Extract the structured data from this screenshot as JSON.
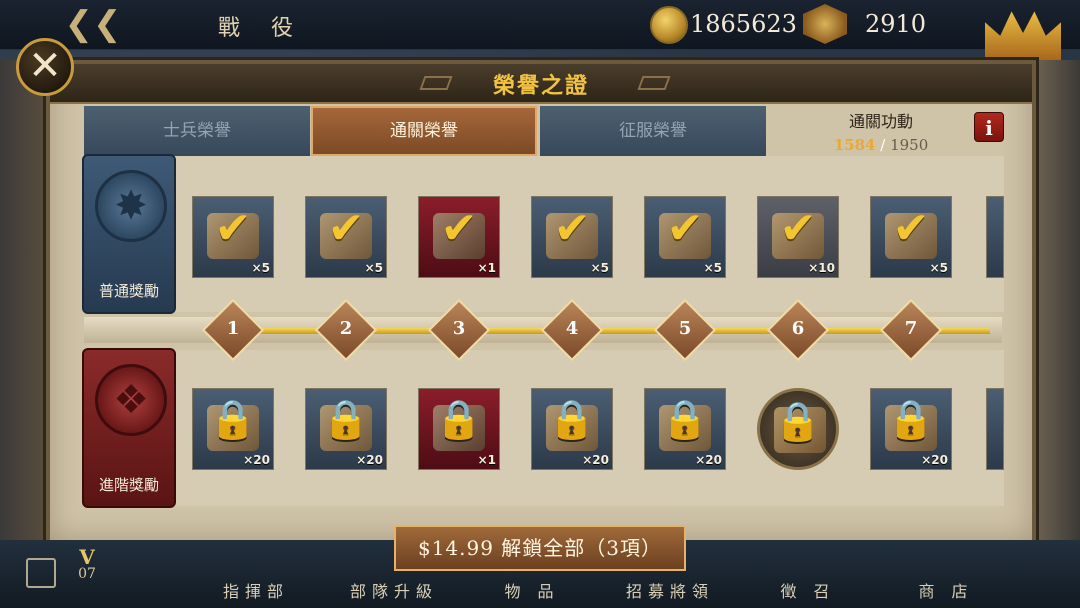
{
  "top_bar": {
    "title": "戰 役",
    "coins": "1865623",
    "crowns": "2910"
  },
  "modal": {
    "title": "榮譽之證",
    "tabs": [
      {
        "label": "士兵榮譽",
        "active": false
      },
      {
        "label": "通關榮譽",
        "active": true
      },
      {
        "label": "征服榮譽",
        "active": false
      }
    ],
    "merit": {
      "label": "通關功動",
      "current": "1584",
      "separator": "/",
      "max": "1950"
    },
    "info_glyph": "i",
    "rows": {
      "normal_label": "普通獎勵",
      "advanced_label": "進階獎勵"
    },
    "levels": [
      "1",
      "2",
      "3",
      "4",
      "5",
      "6",
      "7"
    ],
    "normal_rewards": [
      {
        "icon": "drum-icon",
        "qty": "×5",
        "status": "claimed"
      },
      {
        "icon": "scroll-icon",
        "qty": "×5",
        "status": "claimed"
      },
      {
        "icon": "spear-icon",
        "qty": "×1",
        "status": "claimed"
      },
      {
        "icon": "iron-ingots-icon",
        "qty": "×5",
        "status": "claimed"
      },
      {
        "icon": "map-scroll-icon",
        "qty": "×5",
        "status": "claimed"
      },
      {
        "icon": "puzzle-pieces-icon",
        "qty": "×10",
        "status": "claimed"
      },
      {
        "icon": "coins-trophy-icon",
        "qty": "×5",
        "status": "claimed"
      }
    ],
    "advanced_rewards": [
      {
        "icon": "drum-icon",
        "qty": "×20",
        "status": "locked"
      },
      {
        "icon": "scroll-icon",
        "qty": "×20",
        "status": "locked"
      },
      {
        "icon": "spear-icon",
        "qty": "×1",
        "status": "locked"
      },
      {
        "icon": "iron-ingots-icon",
        "qty": "×20",
        "status": "locked"
      },
      {
        "icon": "map-scroll-icon",
        "qty": "×20",
        "status": "locked"
      },
      {
        "icon": "general-portrait-icon",
        "qty": "",
        "status": "locked"
      },
      {
        "icon": "coins-trophy-icon",
        "qty": "×20",
        "status": "locked"
      }
    ],
    "buy_button": "$14.99 解鎖全部（3項）"
  },
  "bottom_nav": {
    "version_label": "V",
    "version_num": "07",
    "items": [
      "指揮部",
      "部隊升級",
      "物 品",
      "招募將領",
      "徵 召",
      "商 店"
    ]
  },
  "colors": {
    "gold": "#f2c340",
    "claimed_check": "#f2c531",
    "merit_current": "#e8a93a",
    "active_tab": "#a5673a",
    "info_red": "#b2281e"
  }
}
